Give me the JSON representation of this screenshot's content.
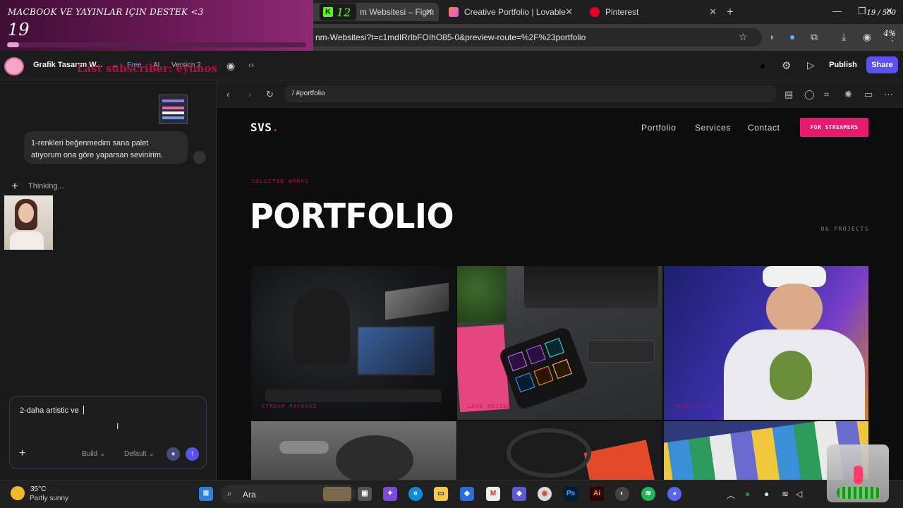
{
  "browser": {
    "tabs": [
      {
        "label": "m Websitesi – Figm",
        "favicon_color": "#a259ff",
        "active": true
      },
      {
        "label": "Creative Portfolio | Lovable",
        "favicon_color": "#ff6b6b",
        "active": false
      },
      {
        "label": "Pinterest",
        "favicon_color": "#e60023",
        "active": false
      }
    ],
    "url": "nm-Websitesi?t=c1mdIRrlbFOIhO85-0&preview-route=%2F%23portfolio"
  },
  "overlay": {
    "title": "MACBOOK VE YAYINLAR IÇIN DESTEK <3",
    "amount": "19",
    "count": "19 / 500",
    "percent_label": "4%",
    "progress_fraction": 0.04,
    "kick_count": "12",
    "last_subscriber": "Last subscriber: eylmos"
  },
  "app": {
    "project_name": "Grafik Tasarım W...",
    "plan": "Free",
    "ai": "AI",
    "version": "Version 2",
    "publish_label": "Publish",
    "share_label": "Share"
  },
  "chat": {
    "user_message": "1-renkleri beğenmedim sana palet atıyorum ona göre yaparsan sevinirim.",
    "thinking": "Thinking...",
    "composer_text": "2-daha artistic ve",
    "build_label": "Build",
    "default_label": "Default"
  },
  "preview": {
    "route": "/ #portfolio"
  },
  "site": {
    "logo": "SVS",
    "logo_dot": ".",
    "nav": [
      "Portfolio",
      "Services",
      "Contact"
    ],
    "cta": "FOR STREAMERS",
    "eyebrow": "SELECTED WORKS",
    "title": "PORTFOLIO",
    "count": "06 PROJECTS",
    "cards": [
      {
        "label": "STREAM PACKAGE"
      },
      {
        "label": "LOGO DESIGN"
      },
      {
        "label": "PROFILE ART"
      },
      {
        "label": ""
      },
      {
        "label": ""
      },
      {
        "label": ""
      }
    ]
  },
  "taskbar": {
    "temp": "35°C",
    "condition": "Partly sunny",
    "search": "Ara"
  },
  "colors": {
    "accent": "#e6196c",
    "accent_dark": "#b3174f",
    "send_button": "#5a52f0",
    "site_bg": "#0d0d0d"
  }
}
